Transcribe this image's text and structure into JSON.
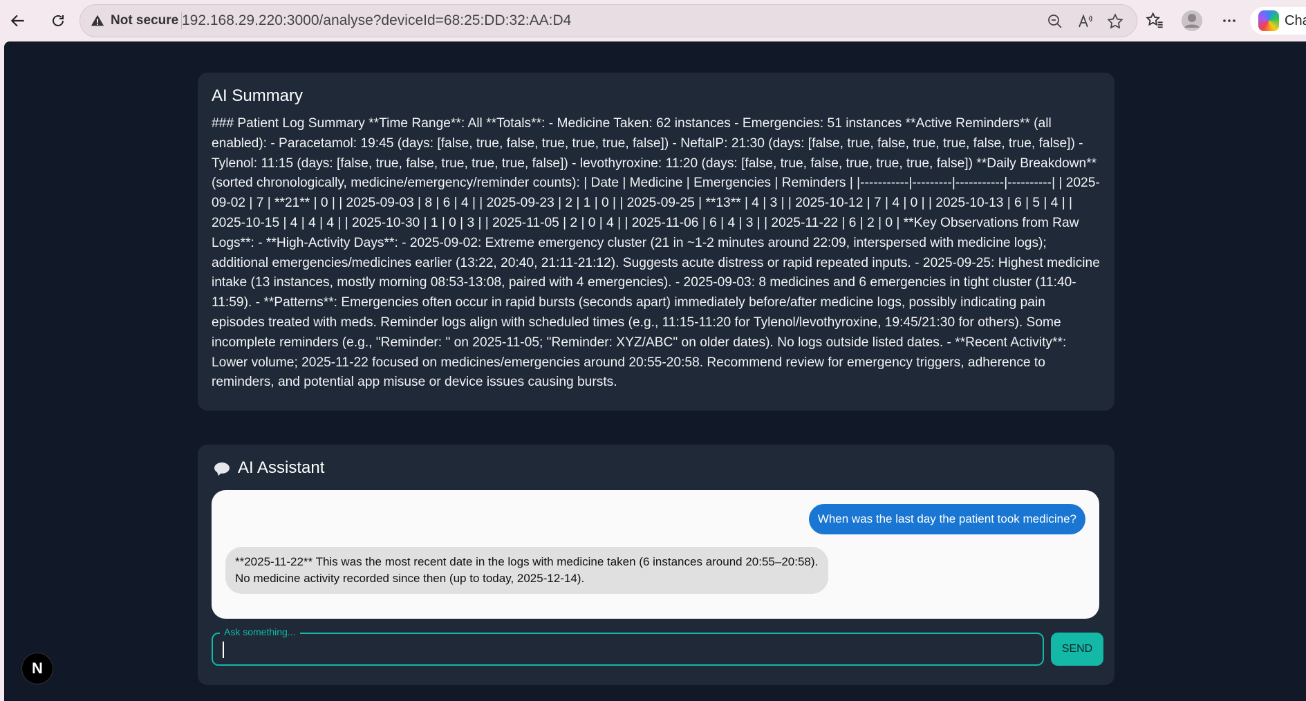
{
  "browser": {
    "security_label": "Not secure",
    "url": "192.168.29.220:3000/analyse?deviceId=68:25:DD:32:AA:D4",
    "copilot_label": "Cha"
  },
  "summary": {
    "title": "AI Summary",
    "text": "### Patient Log Summary **Time Range**: All **Totals**: - Medicine Taken: 62 instances - Emergencies: 51 instances **Active Reminders** (all enabled): - Paracetamol: 19:45 (days: [false, true, false, true, true, true, false]) - NeftalP: 21:30 (days: [false, true, false, true, true, false, true, false]) - Tylenol: 11:15 (days: [false, true, false, true, true, true, false]) - levothyroxine: 11:20 (days: [false, true, false, true, true, true, false]) **Daily Breakdown** (sorted chronologically, medicine/emergency/reminder counts): | Date | Medicine | Emergencies | Reminders | |-----------|---------|-----------|----------| | 2025-09-02 | 7 | **21** | 0 | | 2025-09-03 | 8 | 6 | 4 | | 2025-09-23 | 2 | 1 | 0 | | 2025-09-25 | **13** | 4 | 3 | | 2025-10-12 | 7 | 4 | 0 | | 2025-10-13 | 6 | 5 | 4 | | 2025-10-15 | 4 | 4 | 4 | | 2025-10-30 | 1 | 0 | 3 | | 2025-11-05 | 2 | 0 | 4 | | 2025-11-06 | 6 | 4 | 3 | | 2025-11-22 | 6 | 2 | 0 | **Key Observations from Raw Logs**: - **High-Activity Days**: - 2025-09-02: Extreme emergency cluster (21 in ~1-2 minutes around 22:09, interspersed with medicine logs); additional emergencies/medicines earlier (13:22, 20:40, 21:11-21:12). Suggests acute distress or rapid repeated inputs. - 2025-09-25: Highest medicine intake (13 instances, mostly morning 08:53-13:08, paired with 4 emergencies). - 2025-09-03: 8 medicines and 6 emergencies in tight cluster (11:40-11:59). - **Patterns**: Emergencies often occur in rapid bursts (seconds apart) immediately before/after medicine logs, possibly indicating pain episodes treated with meds. Reminder logs align with scheduled times (e.g., 11:15-11:20 for Tylenol/levothyroxine, 19:45/21:30 for others). Some incomplete reminders (e.g., \"Reminder: \" on 2025-11-05; \"Reminder: XYZ/ABC\" on older dates). No logs outside listed dates. - **Recent Activity**: Lower volume; 2025-11-22 focused on medicines/emergencies around 20:55-20:58. Recommend review for emergency triggers, adherence to reminders, and potential app misuse or device issues causing bursts."
  },
  "assistant": {
    "title": "AI Assistant",
    "messages": [
      {
        "role": "user",
        "text": "When was the last day the patient took medicine?"
      },
      {
        "role": "assistant",
        "text": "**2025-11-22** This was the most recent date in the logs with medicine taken (6 instances around 20:55–20:58). No medicine activity recorded since then (up to today, 2025-12-14)."
      }
    ],
    "input_label": "Ask something...",
    "input_value": "",
    "send_label": "SEND"
  },
  "badge": {
    "label": "N"
  },
  "colors": {
    "page_bg": "#111827",
    "card_bg": "#1f2937",
    "accent": "#14b8a6",
    "user_bubble": "#1976d2",
    "ai_bubble": "#e0e0e0"
  }
}
